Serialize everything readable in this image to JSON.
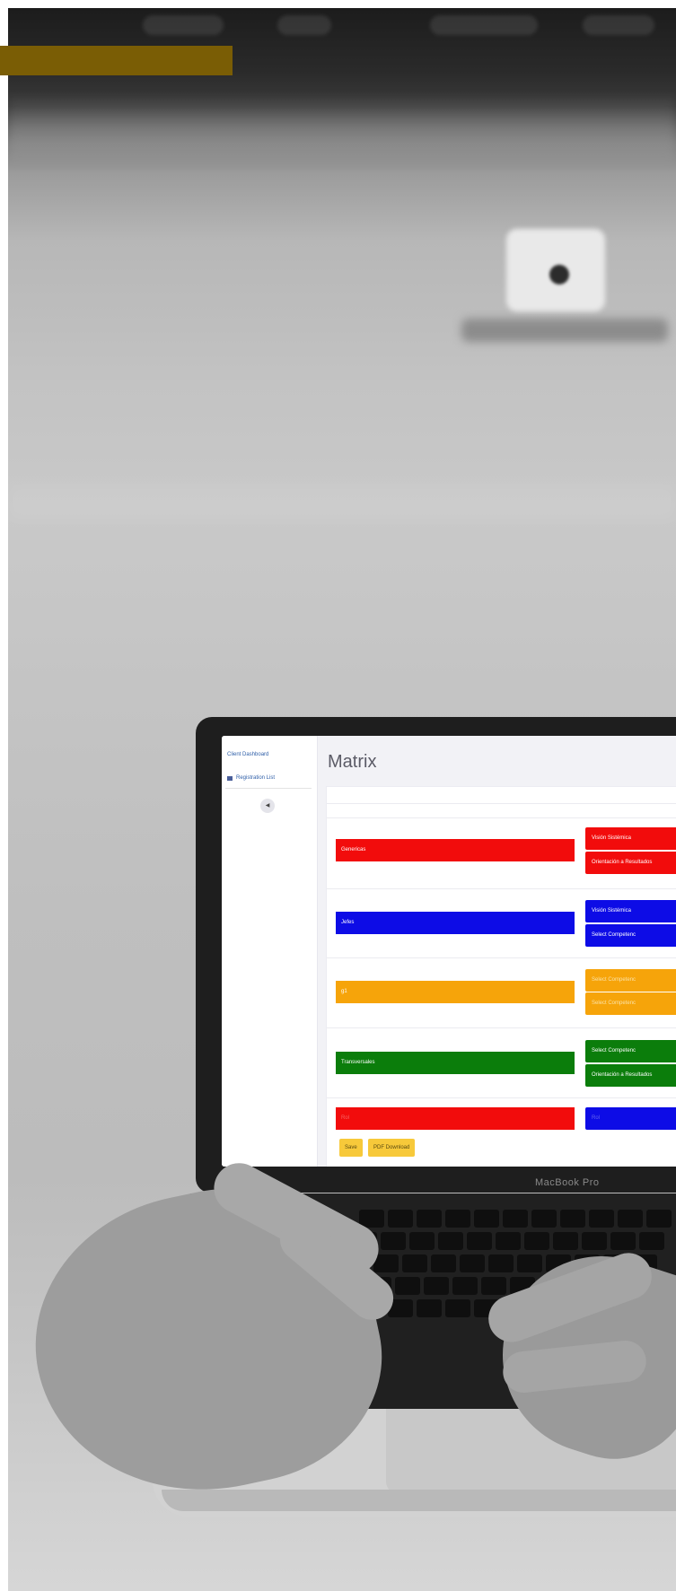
{
  "screen": {
    "sidebar": {
      "dashboard_link": "Client Dashboard",
      "registration_item": "Registration List"
    },
    "page_title": "Matrix",
    "groups": [
      {
        "label": "Genericas",
        "color": "#f20c0c",
        "competences": [
          "Visión Sistémica",
          "Orientación a Resultados"
        ]
      },
      {
        "label": "Jefes",
        "color": "#0d0ce6",
        "competences": [
          "Visión Sistémica",
          "Select Competenc"
        ]
      },
      {
        "label": "g1",
        "color": "#f6a40a",
        "competences": [
          "Select Competenc",
          "Select Competenc"
        ]
      },
      {
        "label": "Transversales",
        "color": "#0b7d0b",
        "competences": [
          "Select Competenc",
          "Orientación a Resultados"
        ]
      },
      {
        "label": "Rol",
        "color": "#f20c0c",
        "competences": [
          "Rol"
        ]
      }
    ],
    "actions": {
      "save": "Save",
      "pdf": "PDF Download"
    }
  },
  "laptop_label": "MacBook Pro",
  "accent_color": "#7a5d05"
}
